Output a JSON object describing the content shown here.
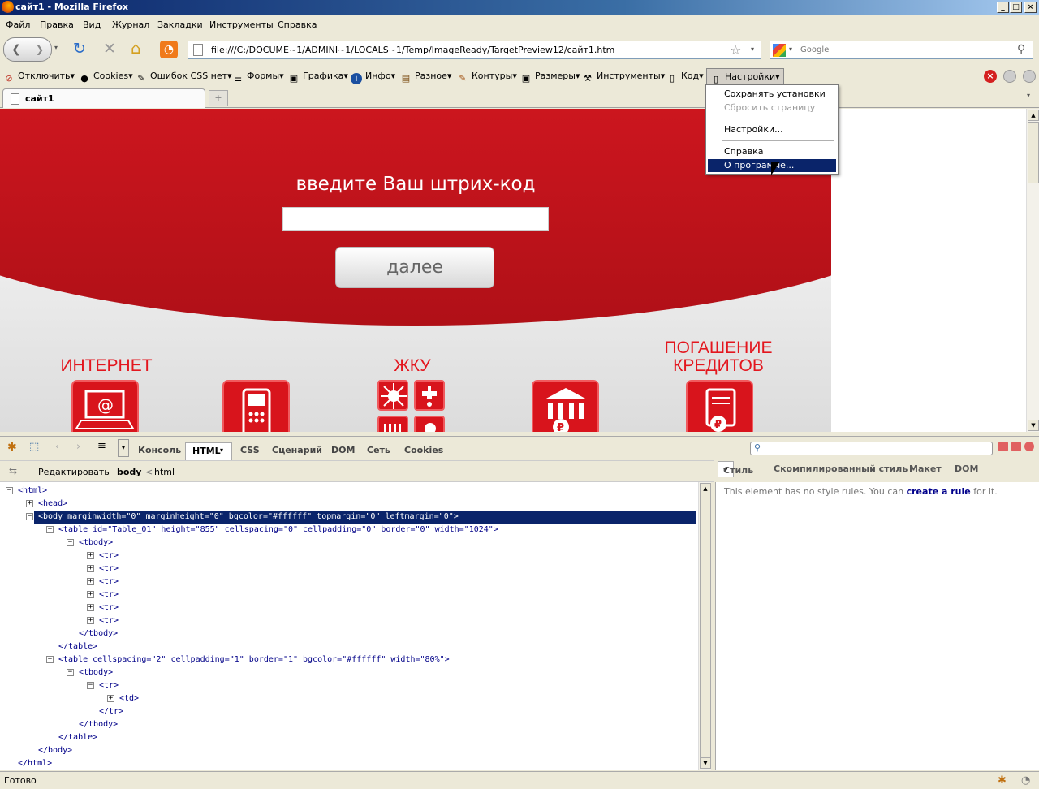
{
  "window": {
    "title": "сайт1 - Mozilla Firefox",
    "min": "_",
    "max": "□",
    "close": "×"
  },
  "menubar": [
    "Файл",
    "Правка",
    "Вид",
    "Журнал",
    "Закладки",
    "Инструменты",
    "Справка"
  ],
  "nav": {
    "back_icon": "back-arrow-icon",
    "forward_icon": "forward-arrow-icon",
    "url": "file:///C:/DOCUME~1/ADMINI~1/LOCALS~1/Temp/ImageReady/TargetPreview12/сайт1.htm",
    "search_placeholder": "Google"
  },
  "webdev_toolbar": [
    {
      "label": "Отключить",
      "icon": "⊘",
      "color": "#c0392b"
    },
    {
      "label": "Cookies",
      "icon": "●",
      "color": "#333"
    },
    {
      "label": "Ошибок CSS нет",
      "icon": "✎",
      "color": "#555"
    },
    {
      "label": "Формы",
      "icon": "☰",
      "color": "#333"
    },
    {
      "label": "Графика",
      "icon": "▣",
      "color": "#345"
    },
    {
      "label": "Инфо",
      "icon": "i",
      "color": "#1a4fa0"
    },
    {
      "label": "Разное",
      "icon": "▤",
      "color": "#7a4a10"
    },
    {
      "label": "Контуры",
      "icon": "✎",
      "color": "#a05010"
    },
    {
      "label": "Размеры",
      "icon": "▣",
      "color": "#345"
    },
    {
      "label": "Инструменты",
      "icon": "⚒",
      "color": "#555"
    },
    {
      "label": "Код",
      "icon": "▯",
      "color": "#555"
    },
    {
      "label": "Настройки",
      "icon": "▯",
      "color": "#555"
    }
  ],
  "tab": {
    "label": "сайт1"
  },
  "page": {
    "heading": "введите Ваш штрих-код",
    "next_button": "далее",
    "categories": [
      {
        "label": "ИНТЕРНЕТ"
      },
      {
        "label": "ЖКУ"
      },
      {
        "label": "ПОГАШЕНИЕ КРЕДИТОВ"
      }
    ],
    "brand_red": "#e01a22"
  },
  "settings_menu": {
    "items": [
      {
        "label": "Сохранять установки",
        "disabled": false
      },
      {
        "label": "Сбросить страницу",
        "disabled": true
      },
      {
        "label": "Настройки...",
        "disabled": false
      },
      {
        "label": "Справка",
        "disabled": false
      },
      {
        "label": "О программе...",
        "disabled": false,
        "highlighted": true
      }
    ]
  },
  "firebug": {
    "tabs": [
      "Консоль",
      "HTML",
      "CSS",
      "Сценарий",
      "DOM",
      "Сеть",
      "Cookies"
    ],
    "active_tab": "HTML",
    "edit_button": "Редактировать",
    "breadcrumb": [
      "body",
      "<",
      "html"
    ],
    "side_tabs": [
      "Стиль",
      "Скомпилированный стиль",
      "Макет",
      "DOM"
    ],
    "side_message_pre": "This element has no style rules. You can ",
    "side_message_link": "create a rule",
    "side_message_post": " for it.",
    "tree": [
      "<html>",
      "<head>",
      "<body marginwidth=\"0\" marginheight=\"0\" bgcolor=\"#ffffff\" topmargin=\"0\" leftmargin=\"0\">",
      "<table id=\"Table_01\" height=\"855\" cellspacing=\"0\" cellpadding=\"0\" border=\"0\" width=\"1024\">",
      "<tbody>",
      "<tr>",
      "<tr>",
      "<tr>",
      "<tr>",
      "<tr>",
      "<tr>",
      "</tbody>",
      "</table>",
      "<table cellspacing=\"2\" cellpadding=\"1\" border=\"1\" bgcolor=\"#ffffff\" width=\"80%\">",
      "<tbody>",
      "<tr>",
      "<td>",
      "</tr>",
      "</tbody>",
      "</table>",
      "</body>",
      "</html>"
    ]
  },
  "status": {
    "text": "Готово"
  }
}
